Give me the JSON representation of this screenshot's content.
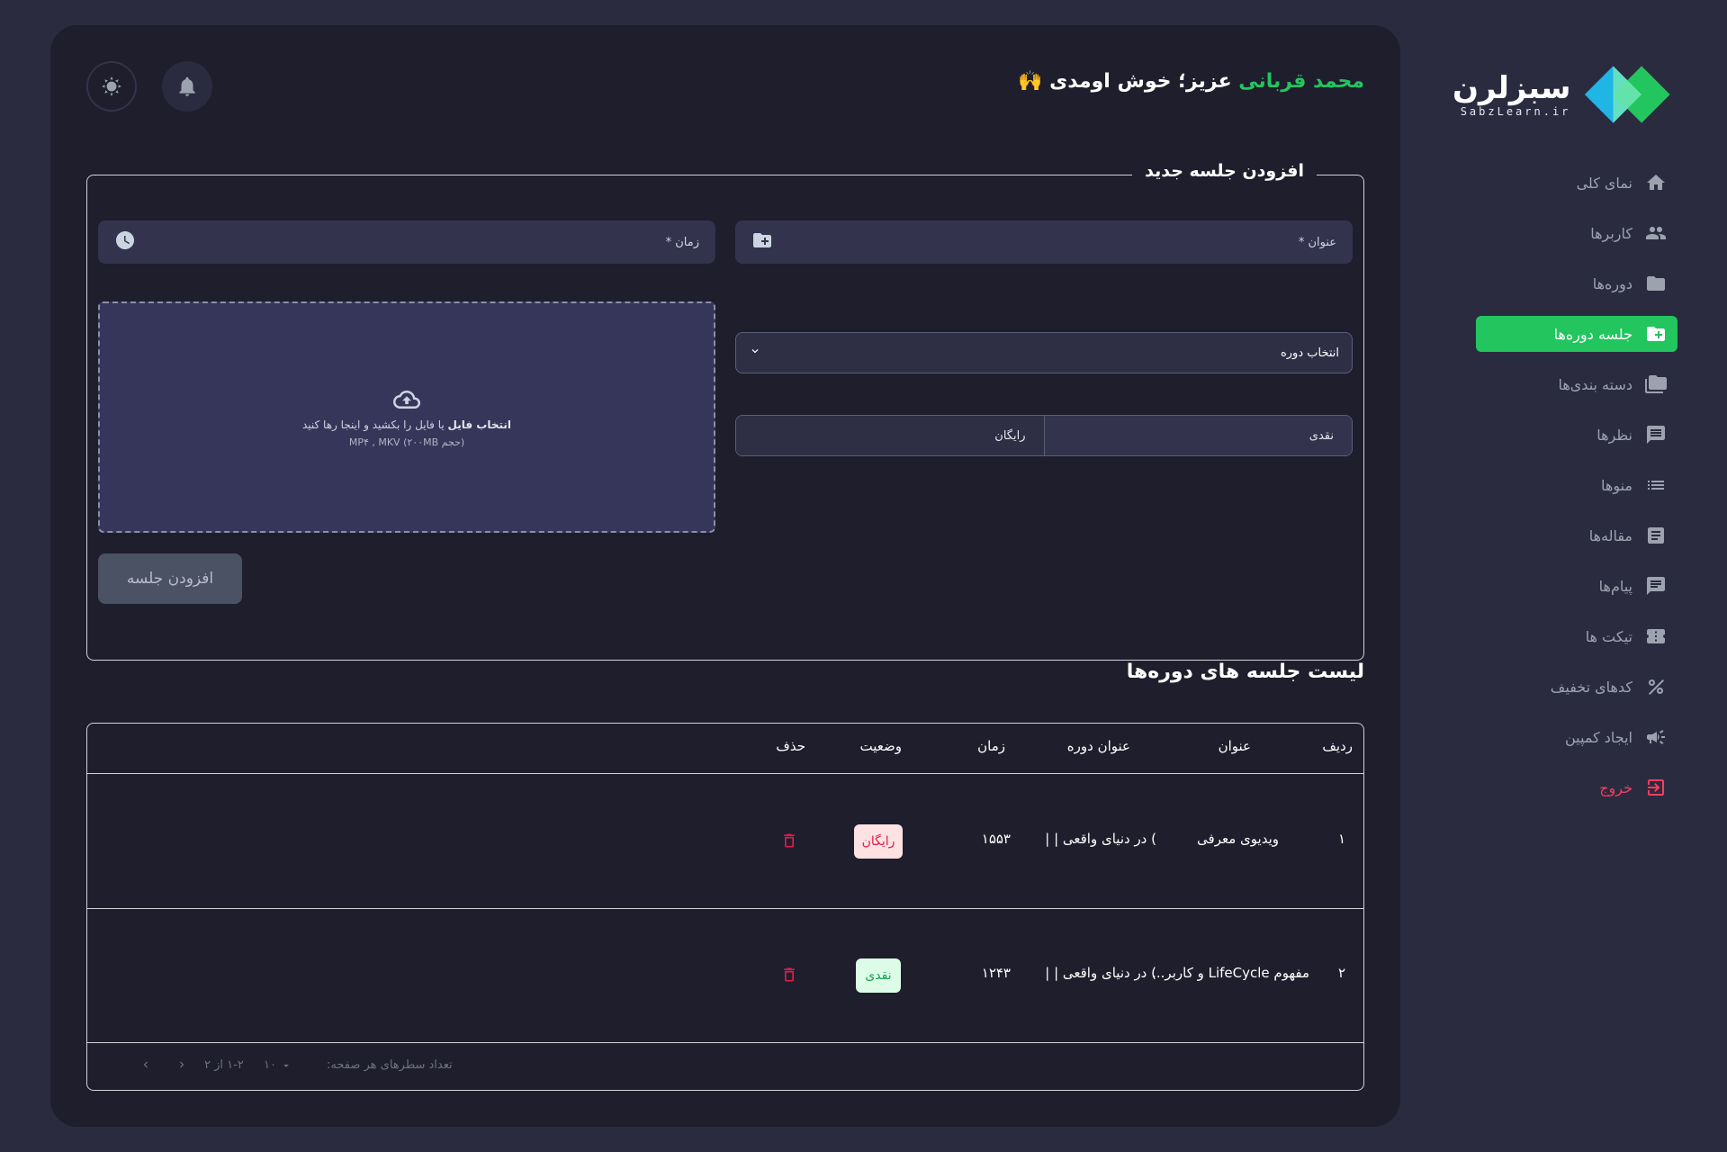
{
  "brand": {
    "logo_fa": "سبزلرن",
    "logo_en": "SabzLearn.ir"
  },
  "header": {
    "welcome_name": "محمد قربانی",
    "welcome_rest": " عزیز؛ خوش اومدی 🙌"
  },
  "sidebar": {
    "items": [
      {
        "label": "نمای کلی",
        "icon": "home-icon"
      },
      {
        "label": "کاربرها",
        "icon": "users-icon"
      },
      {
        "label": "دوره‌ها",
        "icon": "folder-icon"
      },
      {
        "label": "جلسه دوره‌ها",
        "icon": "folder-add-icon",
        "active": true
      },
      {
        "label": "دسته بندی‌ها",
        "icon": "folders-icon"
      },
      {
        "label": "نظرها",
        "icon": "comment-icon"
      },
      {
        "label": "منوها",
        "icon": "list-icon"
      },
      {
        "label": "مقاله‌ها",
        "icon": "article-icon"
      },
      {
        "label": "پیام‌ها",
        "icon": "message-icon"
      },
      {
        "label": "تیکت ها",
        "icon": "ticket-icon"
      },
      {
        "label": "کدهای تخفیف",
        "icon": "percent-icon"
      },
      {
        "label": "ایجاد کمپین",
        "icon": "campaign-icon"
      },
      {
        "label": "خروج",
        "icon": "logout-icon"
      }
    ]
  },
  "form": {
    "legend": "افزودن جلسه جدید",
    "title_placeholder": "عنوان *",
    "time_placeholder": "زمان *",
    "dropzone": {
      "choose": "انتخاب فایل",
      "hint": " یا فایل را بکشید و اینجا رها کنید",
      "sub": "(حجم ۲۰۰MB) MP۴ , MKV"
    },
    "course_select": "انتخاب دوره",
    "price_options": [
      "نقدی",
      "رایگان"
    ],
    "submit": "افزودن جلسه"
  },
  "list": {
    "title": "لیست جلسه های دوره‌ها",
    "columns": [
      "ردیف",
      "عنوان",
      "عنوان دوره",
      "زمان",
      "وضعیت",
      "حذف"
    ],
    "rows": [
      {
        "index": "۱",
        "title": "ویدیوی معرفی",
        "course": ") در دنیای واقعی | |",
        "time": "۱۵۵۳",
        "status": "رایگان"
      },
      {
        "index": "۲",
        "title": "مفهوم LifeCycle و کاربر...",
        "course": ") در دنیای واقعی | |",
        "time": "۱۲۴۳",
        "status": "نقدی"
      }
    ],
    "footer": {
      "rows_per_page_label": "تعداد سطرهای هر صفحه:",
      "rows_per_page": "۱۰",
      "range": "۱-۲ از ۲"
    }
  },
  "colors": {
    "accent": "#22c55e",
    "background": "#2b2b40",
    "panel": "#1e1e2d",
    "danger": "#e11d48"
  }
}
